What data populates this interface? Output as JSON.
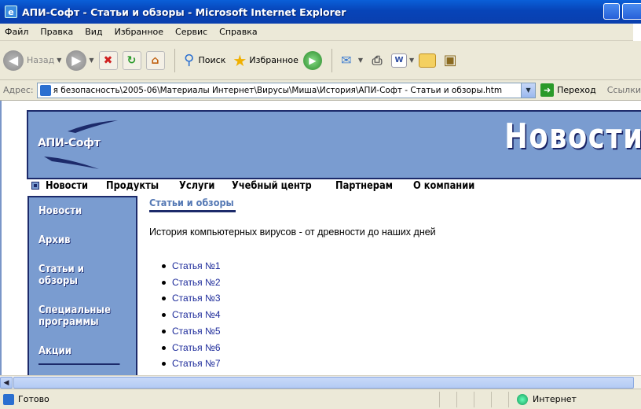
{
  "window": {
    "title": "АПИ-Софт - Статьи и обзоры - Microsoft Internet Explorer"
  },
  "menu": [
    "Файл",
    "Правка",
    "Вид",
    "Избранное",
    "Сервис",
    "Справка"
  ],
  "toolbar": {
    "back": "Назад",
    "search": "Поиск",
    "favorites": "Избранное"
  },
  "address": {
    "label": "Адрес:",
    "value": "я безопасность\\2005-06\\Материалы Интернет\\Вирусы\\Миша\\История\\АПИ-Софт - Статьи и обзоры.htm",
    "go": "Переход",
    "links": "Ссылки"
  },
  "site": {
    "logo": "АПИ-Софт",
    "banner_title": "Новости",
    "nav": [
      "Новости",
      "Продукты",
      "Услуги",
      "Учебный центр",
      "Партнерам",
      "О компании"
    ],
    "sidebar": [
      "Новости",
      "Архив",
      "Статьи и обзоры",
      "Специальные программы",
      "Акции"
    ],
    "section_title": "Статьи и обзоры",
    "intro": "История компьютерных вирусов - от древности до наших дней",
    "articles": [
      "Статья №1",
      "Статья №2",
      "Статья №3",
      "Статья №4",
      "Статья №5",
      "Статья №6",
      "Статья №7"
    ]
  },
  "status": {
    "left": "Готово",
    "zone": "Интернет"
  },
  "colors": {
    "banner": "#7a9cd0",
    "border": "#1c2a6a",
    "link": "#1c2a9a",
    "section": "#5478b4"
  }
}
